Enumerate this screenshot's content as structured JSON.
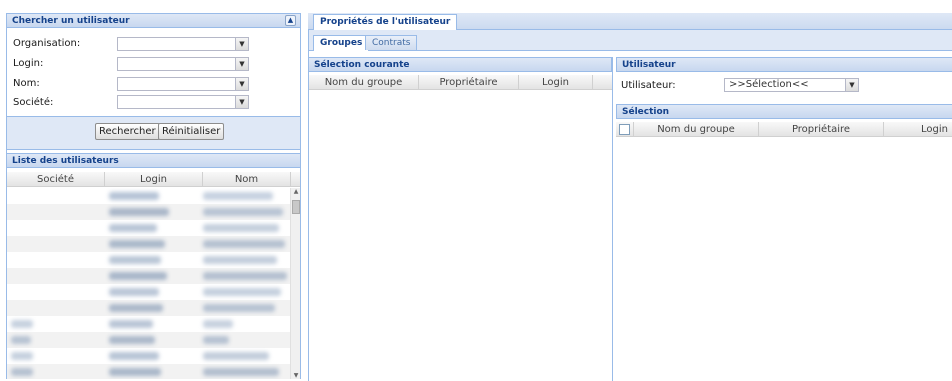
{
  "search_panel": {
    "title": "Chercher un utilisateur",
    "collapse_icon": "double-chevron-up-icon",
    "fields": [
      {
        "label": "Organisation:",
        "value": ""
      },
      {
        "label": "Login:",
        "value": ""
      },
      {
        "label": "Nom:",
        "value": ""
      },
      {
        "label": "Société:",
        "value": ""
      }
    ],
    "search_button": "Rechercher",
    "reset_button": "Réinitialiser"
  },
  "user_list": {
    "title": "Liste des utilisateurs",
    "columns": [
      "Société",
      "Login",
      "Nom"
    ]
  },
  "properties": {
    "window_tab": "Propriétés de l'utilisateur",
    "tabs": [
      "Groupes",
      "Contrats"
    ],
    "active_tab": "Groupes"
  },
  "current_selection": {
    "title": "Sélection courante",
    "columns": [
      "Nom du groupe",
      "Propriétaire",
      "Login"
    ]
  },
  "user_section": {
    "title": "Utilisateur",
    "label": "Utilisateur:",
    "value": ">>Sélection<<"
  },
  "selection": {
    "title": "Sélection",
    "columns": [
      "Nom du groupe",
      "Propriétaire",
      "Login"
    ]
  },
  "colors": {
    "header_text": "#15428b",
    "border": "#99bbe8",
    "header_bg": "#dfe8f6"
  }
}
